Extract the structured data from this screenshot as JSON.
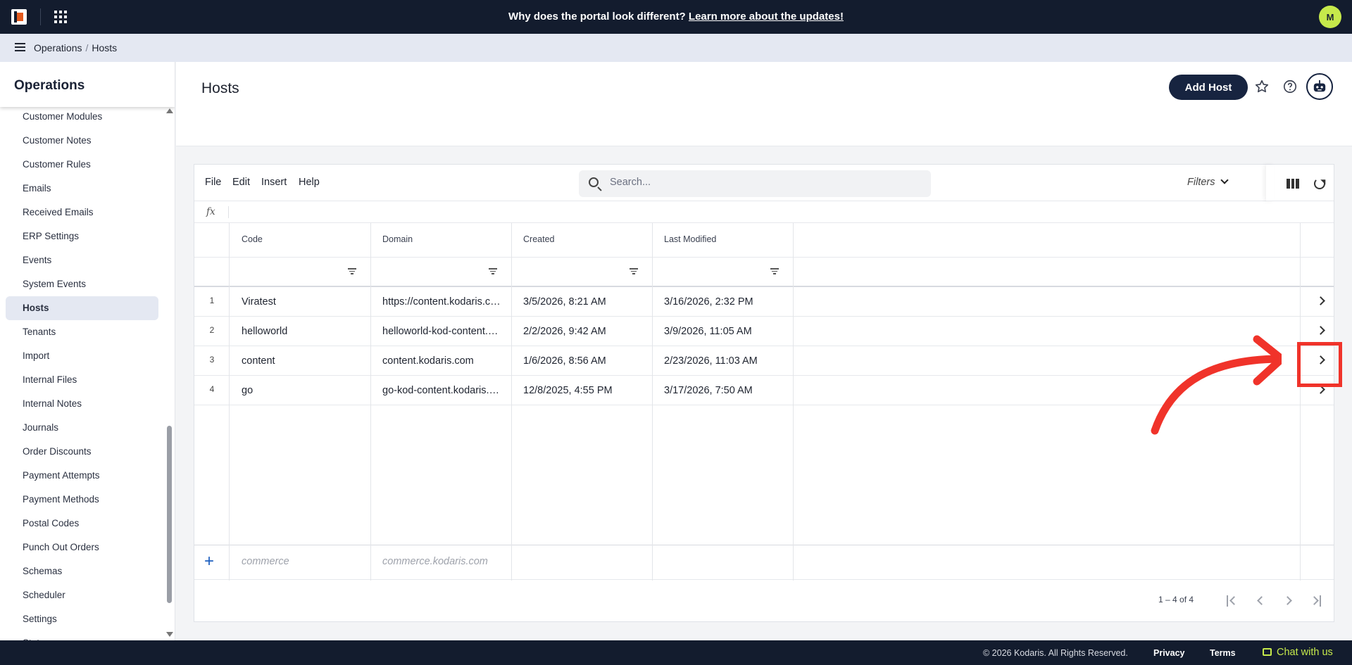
{
  "topbar": {
    "banner_question": "Why does the portal look different?",
    "banner_link": "Learn more about the updates!",
    "avatar_initial": "M"
  },
  "breadcrumb": {
    "parent": "Operations",
    "current": "Hosts"
  },
  "sidebar": {
    "title": "Operations",
    "items": [
      {
        "label": "Customer Modules",
        "active": false
      },
      {
        "label": "Customer Notes",
        "active": false
      },
      {
        "label": "Customer Rules",
        "active": false
      },
      {
        "label": "Emails",
        "active": false
      },
      {
        "label": "Received Emails",
        "active": false
      },
      {
        "label": "ERP Settings",
        "active": false
      },
      {
        "label": "Events",
        "active": false
      },
      {
        "label": "System Events",
        "active": false
      },
      {
        "label": "Hosts",
        "active": true
      },
      {
        "label": "Tenants",
        "active": false
      },
      {
        "label": "Import",
        "active": false
      },
      {
        "label": "Internal Files",
        "active": false
      },
      {
        "label": "Internal Notes",
        "active": false
      },
      {
        "label": "Journals",
        "active": false
      },
      {
        "label": "Order Discounts",
        "active": false
      },
      {
        "label": "Payment Attempts",
        "active": false
      },
      {
        "label": "Payment Methods",
        "active": false
      },
      {
        "label": "Postal Codes",
        "active": false
      },
      {
        "label": "Punch Out Orders",
        "active": false
      },
      {
        "label": "Schemas",
        "active": false
      },
      {
        "label": "Scheduler",
        "active": false
      },
      {
        "label": "Settings",
        "active": false
      },
      {
        "label": "States",
        "active": false
      }
    ]
  },
  "page": {
    "title": "Hosts",
    "add_button": "Add Host"
  },
  "toolbar": {
    "menus": [
      "File",
      "Edit",
      "Insert",
      "Help"
    ],
    "search_placeholder": "Search...",
    "filters_label": "Filters",
    "fx_label": "fx"
  },
  "grid": {
    "columns": [
      "Code",
      "Domain",
      "Created",
      "Last Modified"
    ],
    "rows": [
      {
        "num": "1",
        "code": "Viratest",
        "domain": "https://content.kodaris.com",
        "created": "3/5/2026, 8:21 AM",
        "modified": "3/16/2026, 2:32 PM"
      },
      {
        "num": "2",
        "code": "helloworld",
        "domain": "helloworld-kod-content.kodaris.com",
        "created": "2/2/2026, 9:42 AM",
        "modified": "3/9/2026, 11:05 AM"
      },
      {
        "num": "3",
        "code": "content",
        "domain": "content.kodaris.com",
        "created": "1/6/2026, 8:56 AM",
        "modified": "2/23/2026, 11:03 AM"
      },
      {
        "num": "4",
        "code": "go",
        "domain": "go-kod-content.kodaris.com",
        "created": "12/8/2025, 4:55 PM",
        "modified": "3/17/2026, 7:50 AM"
      }
    ],
    "new_row": {
      "code_placeholder": "commerce",
      "domain_placeholder": "commerce.kodaris.com"
    },
    "pager_text": "1 – 4 of 4"
  },
  "footer": {
    "copyright": "© 2026 Kodaris. All Rights Reserved.",
    "privacy": "Privacy",
    "terms": "Terms",
    "chat": "Chat with us"
  },
  "colors": {
    "navy": "#131c2e",
    "accent": "#c6e94b",
    "annotation": "#f0332a"
  }
}
